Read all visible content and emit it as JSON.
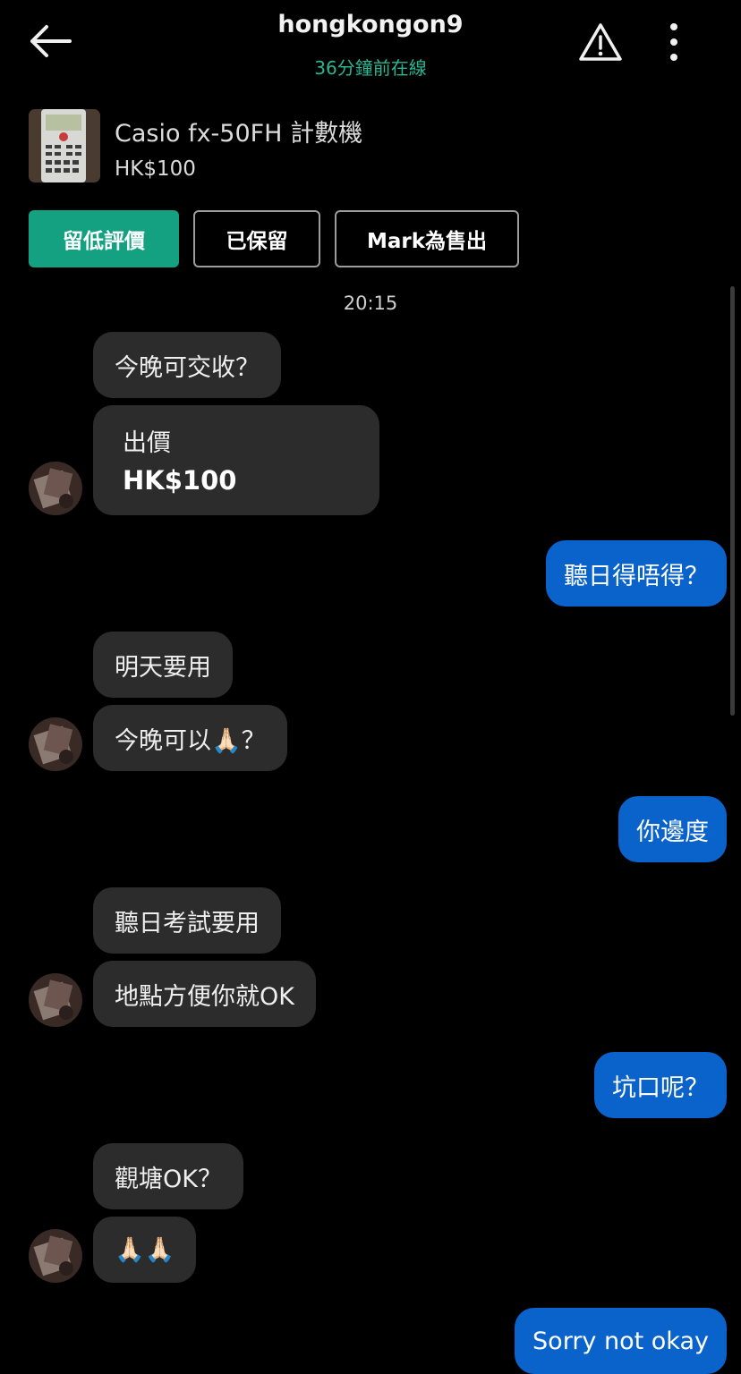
{
  "header": {
    "username": "hongkongon9",
    "status": "36分鐘前在線"
  },
  "product": {
    "name": "Casio fx-50FH 計數機",
    "price": "HK$100"
  },
  "actions": {
    "rate": "留低評價",
    "reserve": "已保留",
    "mark_sold": "Mark為售出"
  },
  "timestamp": "20:15",
  "messages": [
    {
      "from": "them",
      "text": "今晚可交收？"
    },
    {
      "from": "them",
      "type": "offer",
      "title": "出價",
      "amount": "HK$100"
    },
    {
      "from": "me",
      "text": "聽日得唔得？"
    },
    {
      "from": "them",
      "text": "明天要用"
    },
    {
      "from": "them",
      "text": "今晚可以🙏🏻？"
    },
    {
      "from": "me",
      "text": "你邊度"
    },
    {
      "from": "them",
      "text": "聽日考試要用"
    },
    {
      "from": "them",
      "text": "地點方便你就OK"
    },
    {
      "from": "me",
      "text": "坑口呢？"
    },
    {
      "from": "them",
      "text": "觀塘OK？"
    },
    {
      "from": "them",
      "text": "🙏🏻🙏🏻"
    },
    {
      "from": "me",
      "text": "Sorry not okay"
    }
  ],
  "colors": {
    "accent": "#13a182",
    "online_status": "#2bb593",
    "outgoing_bubble": "#0a63cb",
    "incoming_bubble": "#2c2c2c"
  }
}
